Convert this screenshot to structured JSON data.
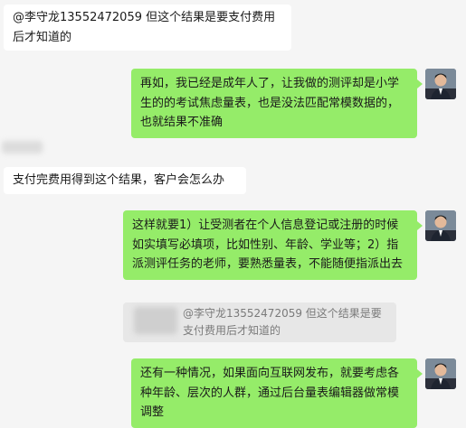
{
  "messages": [
    {
      "text": "@李守龙13552472059 但这个结果是要支付费用后才知道的"
    },
    {
      "text": "再如，我已经是成年人了，让我做的测评却是小学生的的考试焦虑量表，也是没法匹配常模数据的，也就结果不准确"
    },
    {
      "text": "支付完费用得到这个结果，客户会怎么办"
    },
    {
      "text": "这样就要1）让受测者在个人信息登记或注册的时候如实填写必填项，比如性别、年龄、学业等；2）指派测评任务的老师，要熟悉量表，不能随便指派出去"
    },
    {
      "text": "还有一种情况，如果面向互联网发布，就要考虑各种年龄、层次的人群，通过后台量表编辑器做常模调整"
    }
  ],
  "quote": {
    "text": "@李守龙13552472059 但这个结果是要支付费用后才知道的"
  },
  "colors": {
    "background": "#f5f5f5",
    "incoming": "#ffffff",
    "outgoing": "#95ec69",
    "quote": "#e7e7e7"
  }
}
